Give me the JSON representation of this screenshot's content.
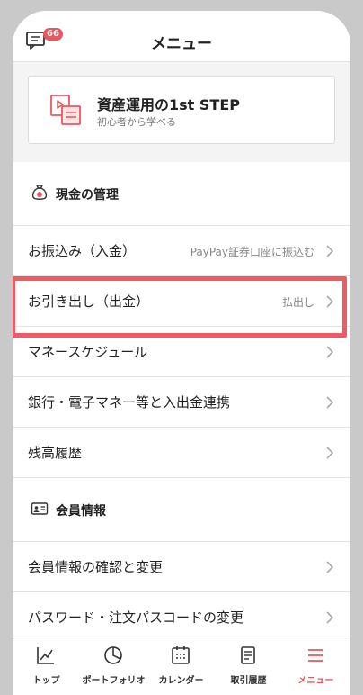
{
  "header": {
    "title": "メニュー",
    "notification_count": "66"
  },
  "promo": {
    "title": "資産運用の1st STEP",
    "subtitle": "初心者から学べる"
  },
  "sections": {
    "cash": {
      "title": "現金の管理",
      "rows": [
        {
          "label": "お振込み（入金）",
          "sub": "PayPay証券口座に振込む"
        },
        {
          "label": "お引き出し（出金）",
          "sub": "払出し"
        },
        {
          "label": "マネースケジュール",
          "sub": ""
        },
        {
          "label": "銀行・電子マネー等と入出金連携",
          "sub": ""
        },
        {
          "label": "残高履歴",
          "sub": ""
        }
      ]
    },
    "member": {
      "title": "会員情報",
      "rows": [
        {
          "label": "会員情報の確認と変更",
          "sub": ""
        },
        {
          "label": "パスワード・注文パスコードの変更",
          "sub": ""
        }
      ]
    }
  },
  "tabs": [
    {
      "label": "トップ",
      "icon": "chart-line-icon"
    },
    {
      "label": "ポートフォリオ",
      "icon": "pie-chart-icon"
    },
    {
      "label": "カレンダー",
      "icon": "calendar-icon"
    },
    {
      "label": "取引履歴",
      "icon": "document-icon"
    },
    {
      "label": "メニュー",
      "icon": "menu-icon",
      "active": true
    }
  ],
  "colors": {
    "accent": "#e8595f",
    "highlight_border": "#f05a62"
  }
}
